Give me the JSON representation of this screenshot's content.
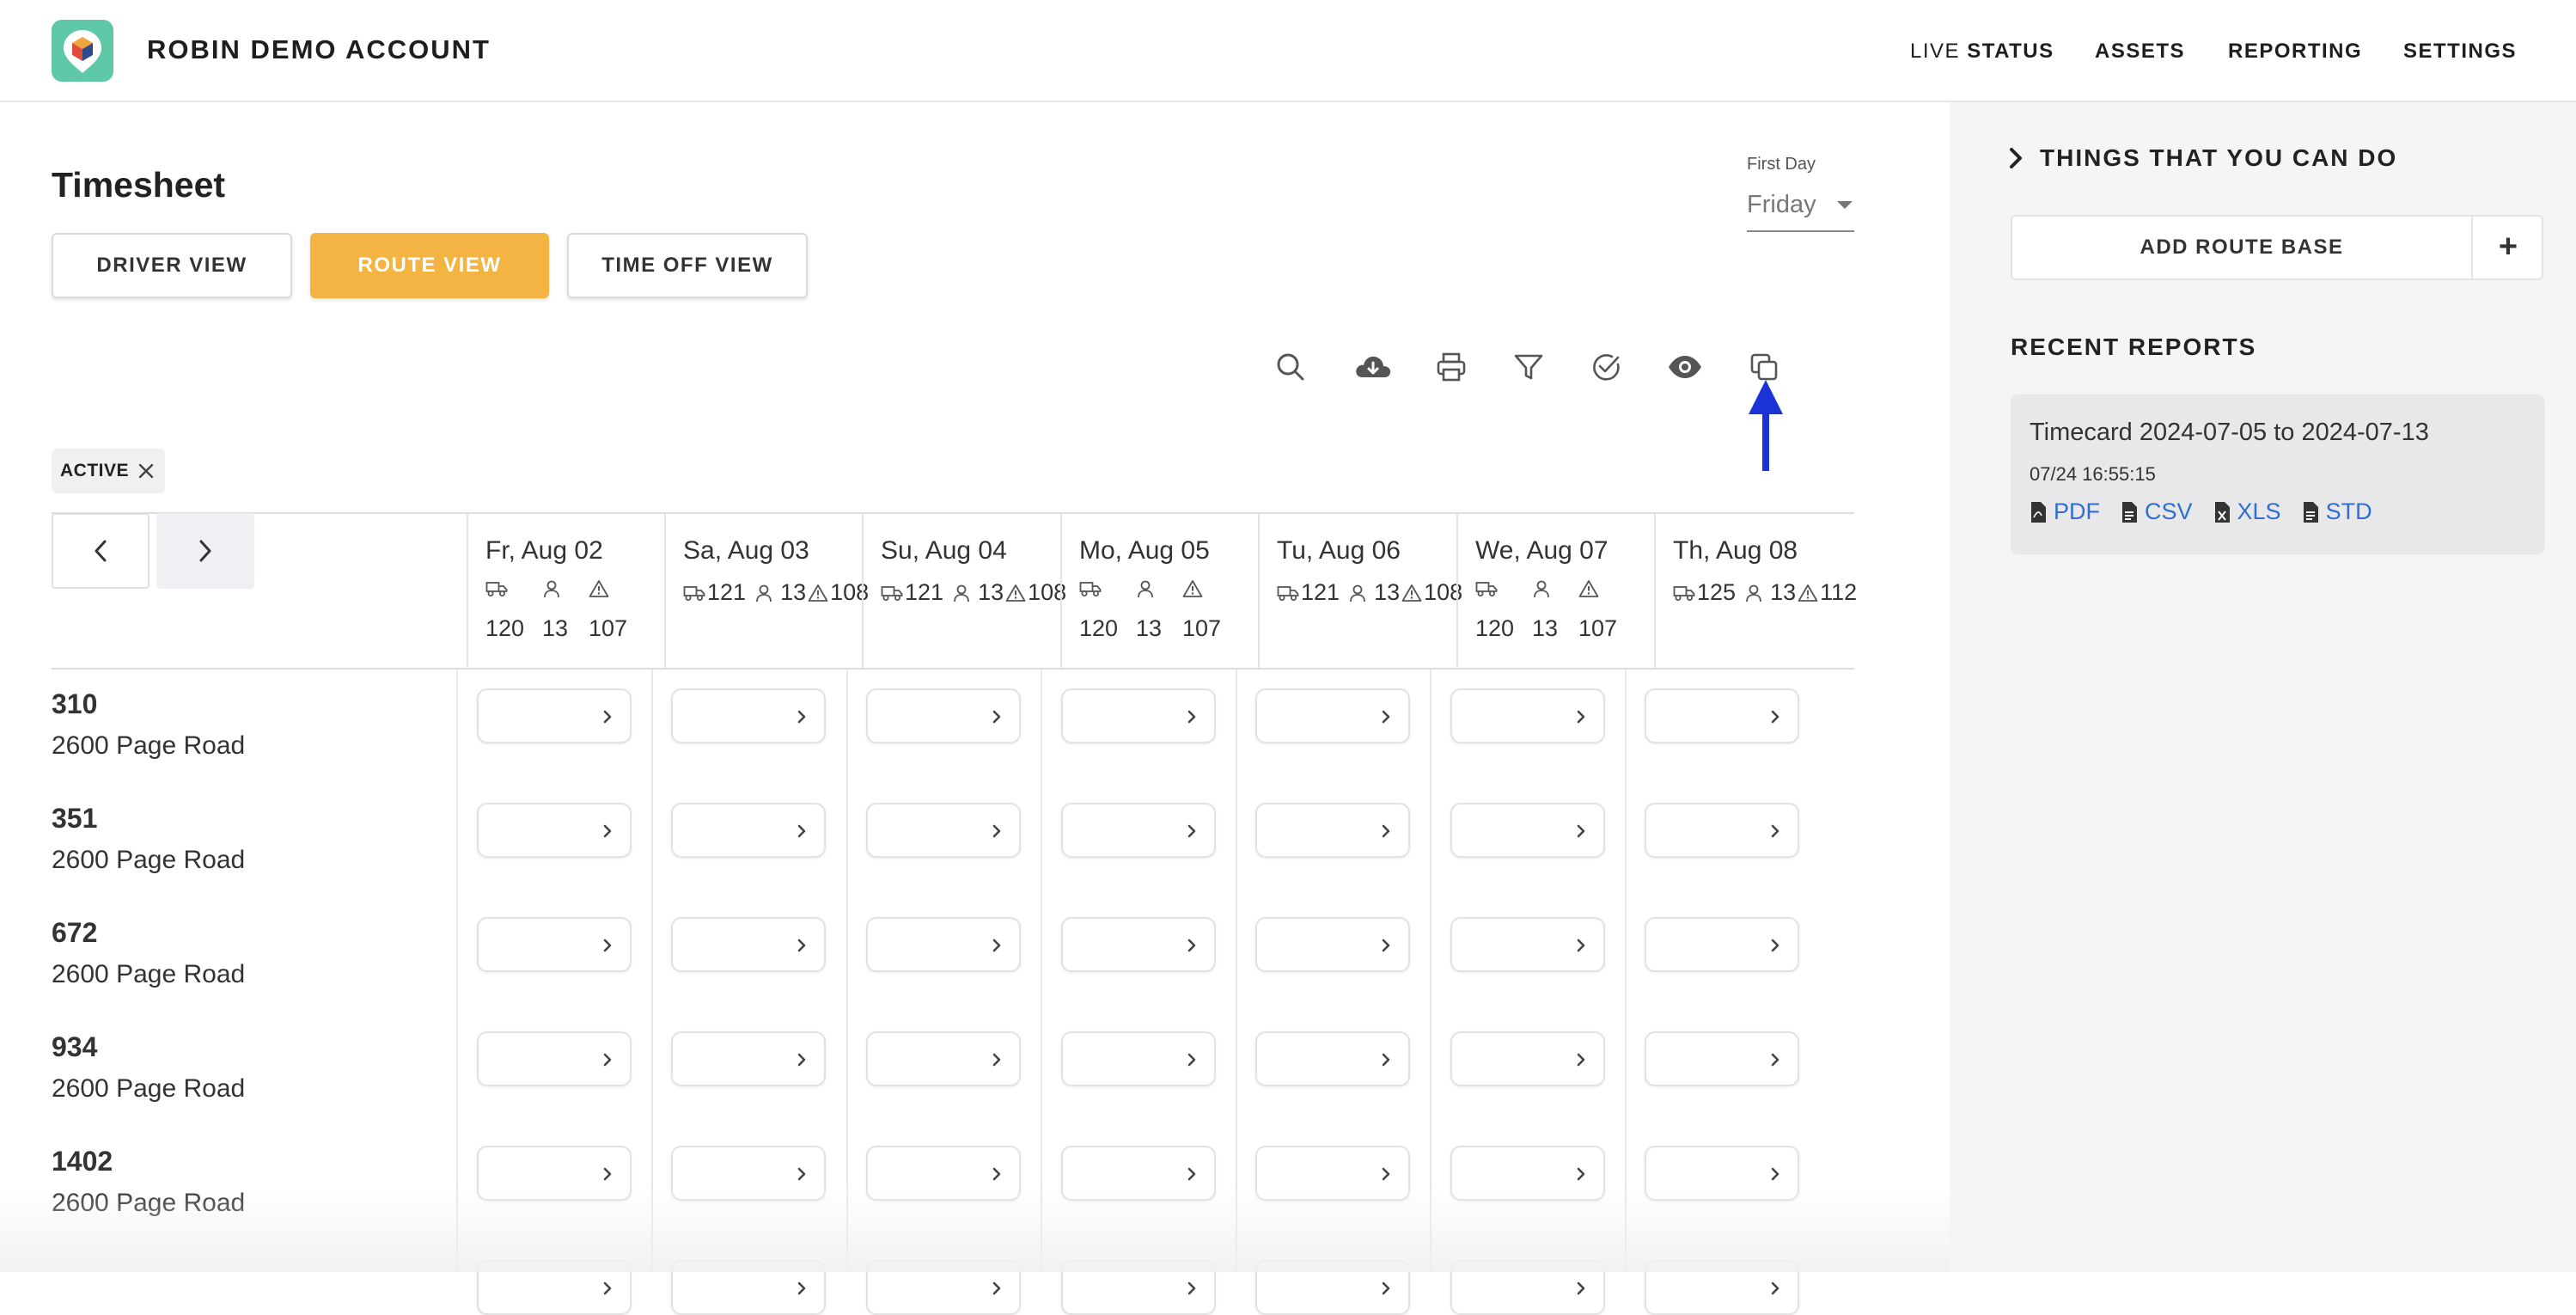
{
  "header": {
    "account_name": "ROBIN DEMO ACCOUNT",
    "nav": {
      "live_prefix": "LIVE",
      "status": "STATUS",
      "assets": "ASSETS",
      "reporting": "REPORTING",
      "settings": "SETTINGS"
    }
  },
  "page": {
    "title": "Timesheet",
    "first_day_label": "First Day",
    "first_day_value": "Friday"
  },
  "views": {
    "driver": "DRIVER VIEW",
    "route": "ROUTE VIEW",
    "timeoff": "TIME OFF VIEW",
    "active_view": "route"
  },
  "toolbar": {
    "icons": [
      "search-icon",
      "cloud-download-icon",
      "print-icon",
      "filter-icon",
      "check-circle-icon",
      "eye-icon",
      "copy-icon"
    ]
  },
  "filter_chip": {
    "label": "ACTIVE"
  },
  "columns": [
    {
      "date": "Fr, Aug 02",
      "vehicles": "120",
      "drivers": "13",
      "alerts": "107",
      "compact": false
    },
    {
      "date": "Sa, Aug 03",
      "vehicles": "121",
      "drivers": "13",
      "alerts": "108",
      "compact": true
    },
    {
      "date": "Su, Aug 04",
      "vehicles": "121",
      "drivers": "13",
      "alerts": "108",
      "compact": true
    },
    {
      "date": "Mo, Aug 05",
      "vehicles": "120",
      "drivers": "13",
      "alerts": "107",
      "compact": false
    },
    {
      "date": "Tu, Aug 06",
      "vehicles": "121",
      "drivers": "13",
      "alerts": "108",
      "compact": true
    },
    {
      "date": "We, Aug 07",
      "vehicles": "120",
      "drivers": "13",
      "alerts": "107",
      "compact": false
    },
    {
      "date": "Th, Aug 08",
      "vehicles": "125",
      "drivers": "13",
      "alerts": "112",
      "compact": true
    }
  ],
  "rows": [
    {
      "route": "310",
      "address": "2600 Page Road"
    },
    {
      "route": "351",
      "address": "2600 Page Road"
    },
    {
      "route": "672",
      "address": "2600 Page Road"
    },
    {
      "route": "934",
      "address": "2600 Page Road"
    },
    {
      "route": "1402",
      "address": "2600 Page Road"
    }
  ],
  "side_panel": {
    "things_title": "THINGS THAT YOU CAN DO",
    "add_route_base": "ADD ROUTE BASE",
    "add_plus": "+",
    "recent_reports_title": "RECENT REPORTS",
    "report": {
      "name": "Timecard 2024-07-05 to 2024-07-13",
      "date": "07/24 16:55:15",
      "links": [
        "PDF",
        "CSV",
        "XLS",
        "STD"
      ]
    }
  },
  "colors": {
    "accent": "#f4b443",
    "logo_bg": "#5ec8a8",
    "link": "#2f6fd1",
    "annotation_arrow": "#1a33d6"
  }
}
